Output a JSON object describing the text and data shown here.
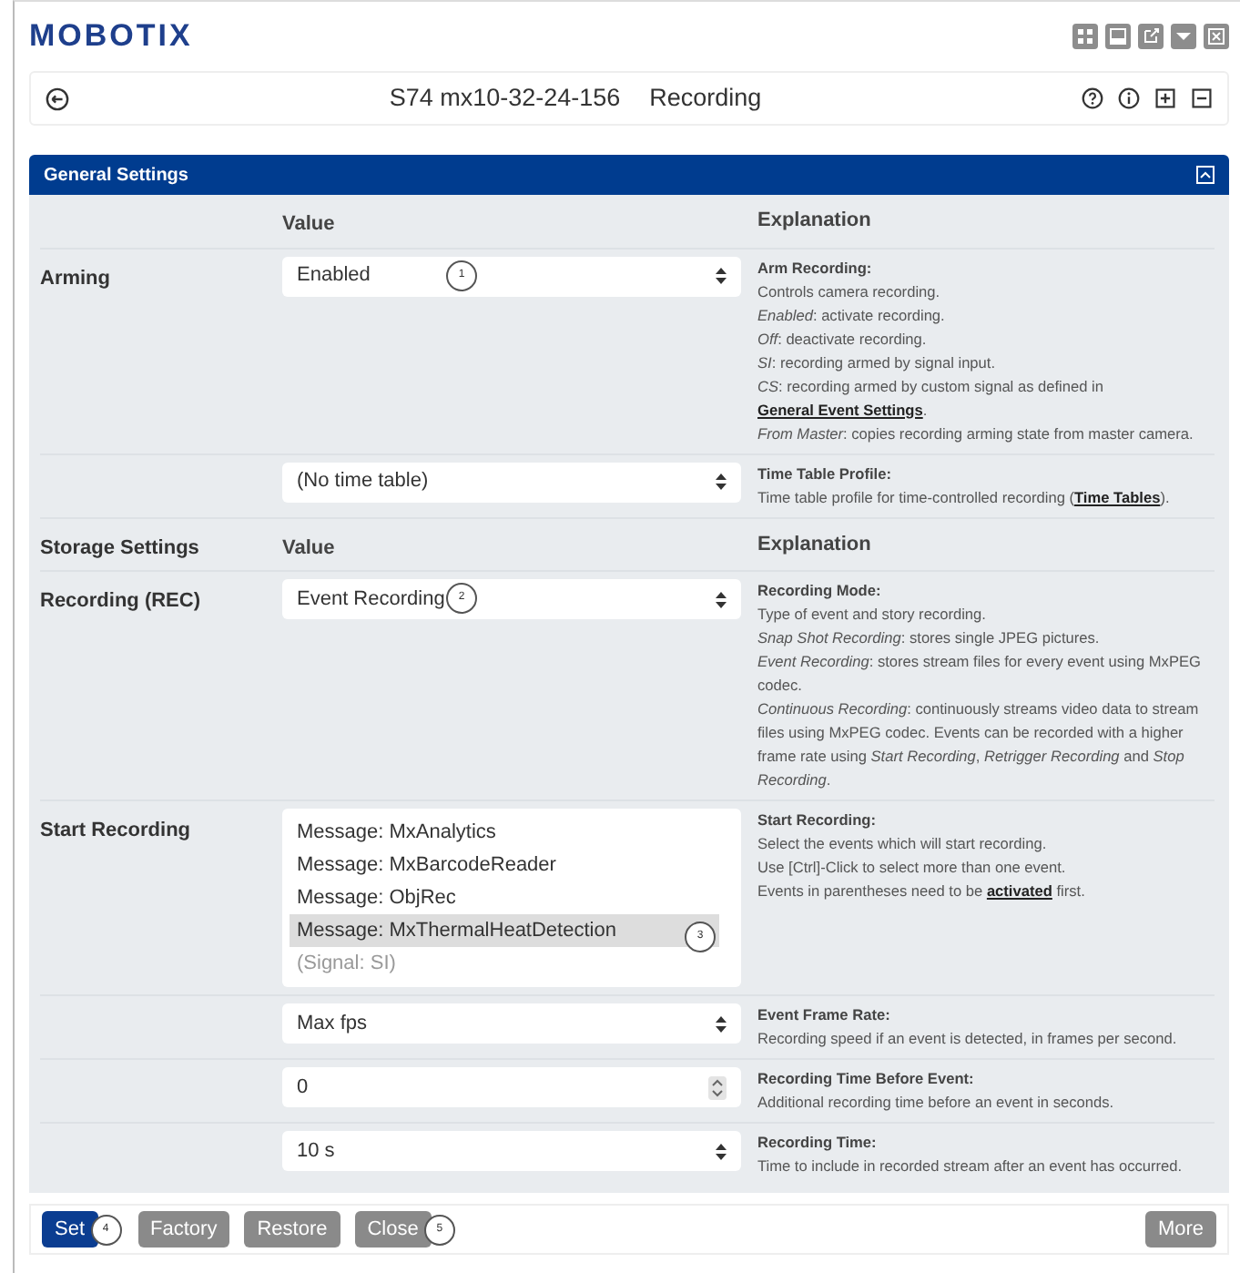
{
  "brand": "MOBOTIX",
  "top_buttons": [
    {
      "kind": "grid"
    },
    {
      "kind": "window"
    },
    {
      "kind": "external"
    },
    {
      "kind": "dropdown"
    },
    {
      "kind": "close"
    }
  ],
  "title_bar": {
    "camera": "S74 mx10-32-24-156",
    "page": "Recording",
    "icons": [
      {
        "kind": "help"
      },
      {
        "kind": "info"
      },
      {
        "kind": "plus"
      },
      {
        "kind": "minus"
      }
    ]
  },
  "panel": {
    "title": "General Settings",
    "expanded": true,
    "rows": [
      {
        "kind": "header",
        "label": "",
        "value": "Value",
        "explanation": "Explanation"
      },
      {
        "kind": "select",
        "label": "Arming",
        "value": "Enabled",
        "callout": "1",
        "title": "Arm Recording:",
        "lines": [
          [
            {
              "text": "Controls camera recording."
            }
          ],
          [
            {
              "text": "*Enabled*: activate recording."
            }
          ],
          [
            {
              "text": "*Off*: deactivate recording."
            }
          ],
          [
            {
              "text": "*SI*: recording armed by signal input."
            }
          ],
          [
            {
              "text": "*CS*: recording armed by custom signal as defined in "
            },
            {
              "text": "General Event Settings",
              "link": true
            },
            {
              "text": "."
            }
          ],
          [
            {
              "text": "*From Master*: copies recording arming state from master camera."
            }
          ]
        ]
      },
      {
        "kind": "select",
        "label": "",
        "value": "(No time table)",
        "title": "Time Table Profile:",
        "lines": [
          [
            {
              "text": "Time table profile for time-controlled recording ("
            },
            {
              "text": "Time Tables",
              "link": true
            },
            {
              "text": ")."
            }
          ]
        ]
      },
      {
        "kind": "header",
        "label": "Storage Settings",
        "value": "Value",
        "explanation": "Explanation"
      },
      {
        "kind": "select",
        "label": "Recording (REC)",
        "value": "Event Recording",
        "callout": "2",
        "title": "Recording Mode:",
        "lines": [
          [
            {
              "text": "Type of event and story recording."
            }
          ],
          [
            {
              "text": "*Snap Shot Recording*: stores single JPEG pictures."
            }
          ],
          [
            {
              "text": "*Event Recording*: stores stream files for every event using MxPEG codec."
            }
          ],
          [
            {
              "text": "*Continuous Recording*: continuously streams video data to stream files using MxPEG codec. Events can be recorded with a higher frame rate using *Start Recording*, *Retrigger Recording* and *Stop Recording*."
            }
          ]
        ]
      },
      {
        "kind": "listbox",
        "label": "Start Recording",
        "callout": "3",
        "options": [
          {
            "text": "Message: MxAnalytics",
            "selected": false,
            "disabled": false
          },
          {
            "text": "Message: MxBarcodeReader",
            "selected": false,
            "disabled": false
          },
          {
            "text": "Message: ObjRec",
            "selected": false,
            "disabled": false
          },
          {
            "text": "Message: MxThermalHeatDetection",
            "selected": true,
            "disabled": false
          },
          {
            "text": "(Signal: SI)",
            "selected": false,
            "disabled": true
          }
        ],
        "title": "Start Recording:",
        "lines": [
          [
            {
              "text": "Select the events which will start recording."
            }
          ],
          [
            {
              "text": "Use [Ctrl]-Click to select more than one event."
            }
          ],
          [
            {
              "text": "Events in parentheses need to be "
            },
            {
              "text": "activated",
              "link": true
            },
            {
              "text": " first."
            }
          ]
        ]
      },
      {
        "kind": "select",
        "label": "",
        "value": "Max fps",
        "title": "Event Frame Rate:",
        "lines": [
          [
            {
              "text": "Recording speed if an event is detected, in frames per second."
            }
          ]
        ]
      },
      {
        "kind": "number",
        "label": "",
        "value": "0",
        "title": "Recording Time Before Event:",
        "lines": [
          [
            {
              "text": "Additional recording time before an event in seconds."
            }
          ]
        ]
      },
      {
        "kind": "select",
        "label": "",
        "value": "10 s",
        "title": "Recording Time:",
        "lines": [
          [
            {
              "text": "Time to include in recorded stream after an event has occurred."
            }
          ]
        ]
      }
    ]
  },
  "footer": {
    "buttons": [
      {
        "label": "Set",
        "kind": "primary",
        "callout": "4"
      },
      {
        "label": "Factory",
        "kind": "secondary"
      },
      {
        "label": "Restore",
        "kind": "secondary"
      },
      {
        "label": "Close",
        "kind": "secondary",
        "callout": "5"
      }
    ],
    "more": "More"
  }
}
